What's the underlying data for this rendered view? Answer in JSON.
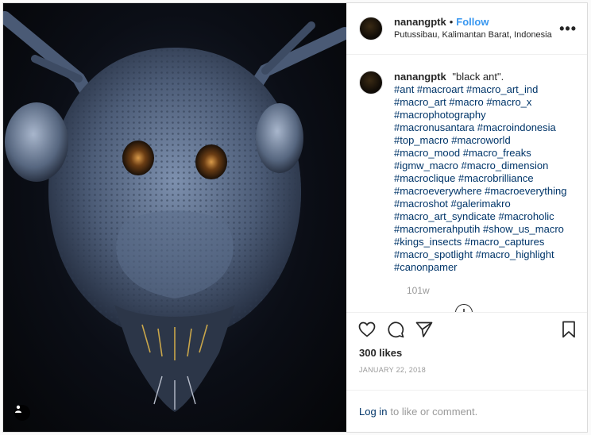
{
  "header": {
    "username": "nanangptk",
    "separator": "•",
    "follow_label": "Follow",
    "location": "Putussibau, Kalimantan Barat, Indonesia",
    "more_label": "•••"
  },
  "caption": {
    "username": "nanangptk",
    "text": "\"black ant\".",
    "hashtag_lines": [
      "#ant #macroart #macro_art_ind",
      "#macro_art #macro #macro_x",
      "#macrophotography",
      "#macronusantara #macroindonesia",
      "#top_macro #macroworld",
      "#macro_mood #macro_freaks",
      "#igmw_macro #macro_dimension",
      "#macroclique #macrobrilliance",
      "#macroeverywhere #macroeverything",
      "#macroshot #galerimakro",
      "#macro_art_syndicate #macroholic",
      "#macromerahputih #show_us_macro",
      "#kings_insects #macro_captures",
      "#macro_spotlight #macro_highlight",
      "#canonpamer"
    ],
    "time": "101w"
  },
  "stats": {
    "likes": "300 likes",
    "date": "JANUARY 22, 2018"
  },
  "footer": {
    "login_link": "Log in",
    "login_text": "to like or comment."
  },
  "colors": {
    "link_blue": "#3897f0",
    "hashtag": "#003569",
    "muted": "#999999",
    "border": "#dbdbdb"
  }
}
